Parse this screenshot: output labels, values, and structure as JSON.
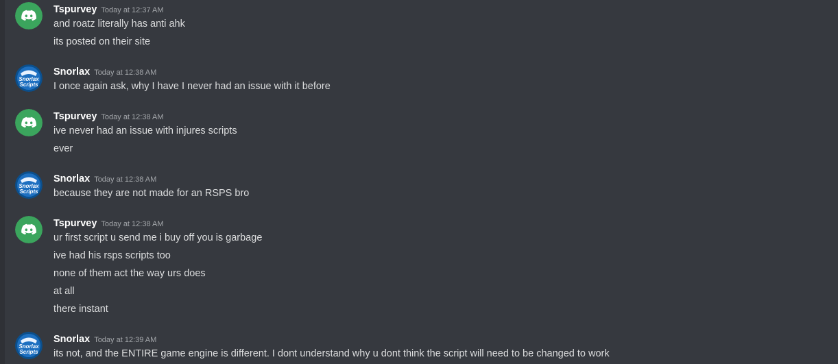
{
  "messages": [
    {
      "author": "Tspurvey",
      "avatar_icon": "discord-default-avatar-icon",
      "avatar_color": "#3ba55d",
      "timestamp": "Today at 12:37 AM",
      "lines": [
        "and roatz literally has anti ahk",
        "its posted on their site"
      ]
    },
    {
      "author": "Snorlax",
      "avatar_icon": "snorlax-scripts-avatar-icon",
      "avatar_color": "#0b4f8c",
      "avatar_text": [
        "Snorlax",
        "Scripts"
      ],
      "timestamp": "Today at 12:38 AM",
      "lines": [
        "I once again ask, why I have I never had an issue with it before"
      ]
    },
    {
      "author": "Tspurvey",
      "avatar_icon": "discord-default-avatar-icon",
      "avatar_color": "#3ba55d",
      "timestamp": "Today at 12:38 AM",
      "lines": [
        "ive never had an issue with injures scripts",
        "ever"
      ]
    },
    {
      "author": "Snorlax",
      "avatar_icon": "snorlax-scripts-avatar-icon",
      "avatar_color": "#0b4f8c",
      "avatar_text": [
        "Snorlax",
        "Scripts"
      ],
      "timestamp": "Today at 12:38 AM",
      "lines": [
        "because they are not made for an RSPS bro"
      ]
    },
    {
      "author": "Tspurvey",
      "avatar_icon": "discord-default-avatar-icon",
      "avatar_color": "#3ba55d",
      "timestamp": "Today at 12:38 AM",
      "lines": [
        "ur first script u send me i buy off you is garbage",
        "ive had his rsps scripts too",
        "none of them act the way urs does",
        "at all",
        "there instant"
      ]
    },
    {
      "author": "Snorlax",
      "avatar_icon": "snorlax-scripts-avatar-icon",
      "avatar_color": "#0b4f8c",
      "avatar_text": [
        "Snorlax",
        "Scripts"
      ],
      "timestamp": "Today at 12:39 AM",
      "lines": [
        "its not, and the ENTIRE game engine is different. I dont understand why u dont think the script will need to be changed to work"
      ]
    }
  ]
}
